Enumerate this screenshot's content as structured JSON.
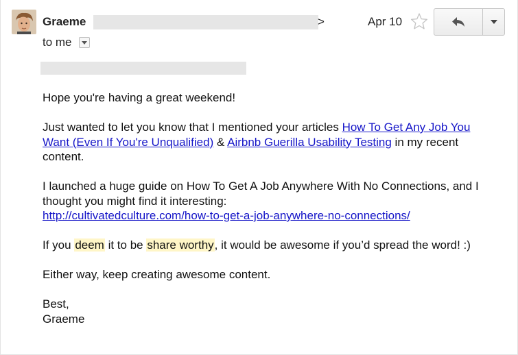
{
  "header": {
    "sender_name": "Graeme",
    "sender_email_tail": ">",
    "date": "Apr 10",
    "recipient": "to me"
  },
  "icons": {
    "avatar": "avatar-photo",
    "star": "star-outline-icon",
    "reply": "reply-arrow-icon",
    "more": "dropdown-caret-icon",
    "recipients_toggle": "small-caret-icon"
  },
  "message": {
    "greeting": "Hope you're having a great weekend!",
    "p2_before": "Just wanted to let you know that I mentioned your articles ",
    "link1": "How To Get Any Job You Want (Even If You're Unqualified)",
    "p2_amp": " & ",
    "link2": "Airbnb Guerilla Usability Testing",
    "p2_after": " in my recent content.",
    "p3_text": "I launched a huge guide on How To Get A Job Anywhere With No Connections, and I thought you might find it interesting:",
    "p3_link": "http://cultivatedculture.com/how-to-get-a-job-anywhere-no-connections/",
    "p4_a": "If you ",
    "p4_hl1": "deem",
    "p4_b": " it to be ",
    "p4_hl2": "share worthy",
    "p4_c": ", it would be awesome if you’d spread the word! :)",
    "p5": "Either way, keep creating awesome content.",
    "signoff": "Best,",
    "signature": "Graeme"
  },
  "colors": {
    "link": "#1515c8",
    "highlight": "#fff6c7",
    "redaction": "#e6e6e6"
  }
}
